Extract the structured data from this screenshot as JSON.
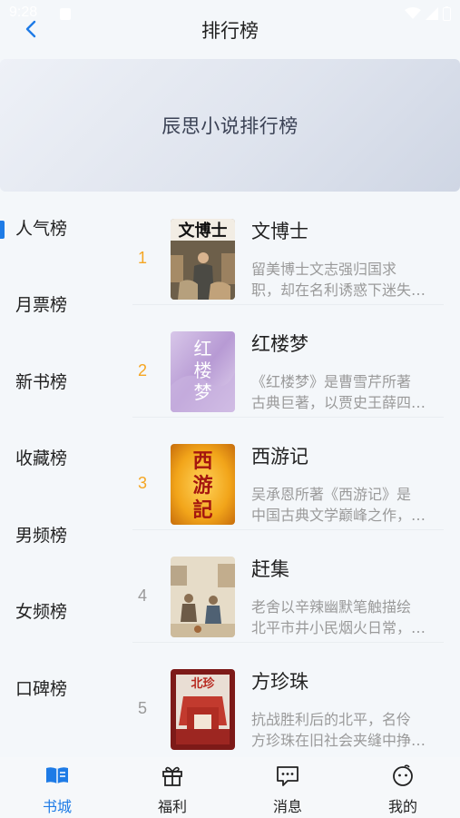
{
  "status_bar": {
    "time": "9:28"
  },
  "header": {
    "title": "排行榜"
  },
  "banner": {
    "title": "辰思小说排行榜"
  },
  "sidebar": {
    "items": [
      {
        "label": "人气榜",
        "active": true
      },
      {
        "label": "月票榜"
      },
      {
        "label": "新书榜"
      },
      {
        "label": "收藏榜"
      },
      {
        "label": "男频榜"
      },
      {
        "label": "女频榜"
      },
      {
        "label": "口碑榜"
      }
    ]
  },
  "books": [
    {
      "rank": "1",
      "title": "文博士",
      "cover_text": "文博士",
      "desc_line1": "留美博士文志强归国求",
      "desc_line2": "职，却在名利诱惑下迷失…"
    },
    {
      "rank": "2",
      "title": "红楼梦",
      "cover_text": "红楼梦",
      "desc_line1": "《红楼梦》是曹雪芹所著",
      "desc_line2": "古典巨著，以贾史王薛四…"
    },
    {
      "rank": "3",
      "title": "西游记",
      "cover_text": "西游記",
      "desc_line1": "吴承恩所著《西游记》是",
      "desc_line2": "中国古典文学巅峰之作，…"
    },
    {
      "rank": "4",
      "title": "赶集",
      "desc_line1": "老舍以辛辣幽默笔触描绘",
      "desc_line2": "北平市井小民烟火日常，…"
    },
    {
      "rank": "5",
      "title": "方珍珠",
      "cover_text": "北珍",
      "desc_line1": "抗战胜利后的北平，名伶",
      "desc_line2": "方珍珠在旧社会夹缝中挣…"
    }
  ],
  "colors": {
    "accent": "#1e7be6",
    "rank_top": "#f5a623",
    "rank_other": "#9a9a9a"
  },
  "tabbar": {
    "tabs": [
      {
        "label": "书城",
        "icon": "book-icon",
        "active": true
      },
      {
        "label": "福利",
        "icon": "gift-icon"
      },
      {
        "label": "消息",
        "icon": "message-icon"
      },
      {
        "label": "我的",
        "icon": "face-icon"
      }
    ]
  }
}
